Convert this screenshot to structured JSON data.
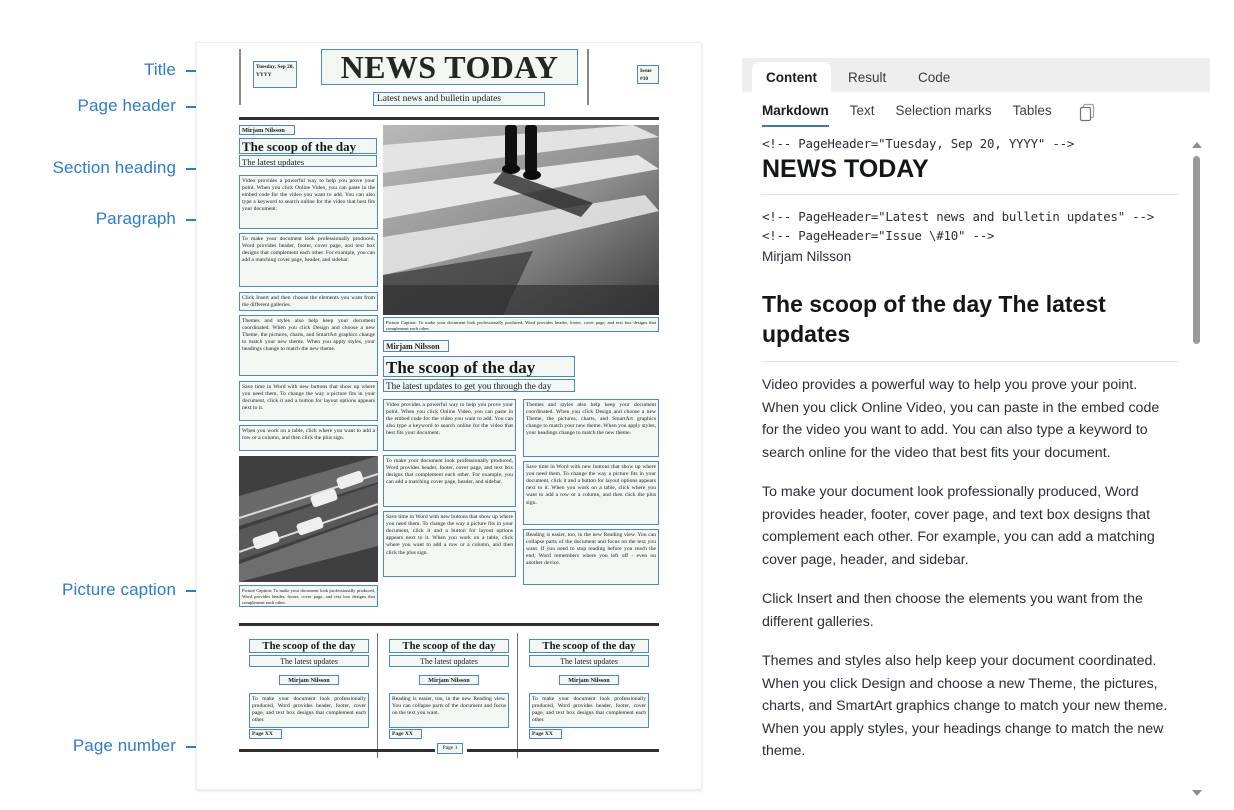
{
  "annotations": [
    {
      "label": "Title",
      "target": "document-title"
    },
    {
      "label": "Page header",
      "target": "page-header"
    },
    {
      "label": "Section heading",
      "target": "section-heading"
    },
    {
      "label": "Paragraph",
      "target": "paragraph"
    },
    {
      "label": "Picture caption",
      "target": "picture-caption"
    },
    {
      "label": "Page number",
      "target": "page-number"
    }
  ],
  "accent_color": "#2b7cd3",
  "region_outline_color": "#4a86d8",
  "document": {
    "masthead": {
      "title": "NEWS TODAY",
      "date": "Tuesday, Sep 20, YYYY",
      "issue": "Issue #10",
      "subtitle": "Latest news and bulletin updates"
    },
    "section_one": {
      "byline": "Mirjam Nilsson",
      "heading": "The scoop of the day",
      "subheading": "The latest updates",
      "paragraphs": [
        "Video provides a powerful way to help you prove your point. When you click Online Video, you can paste in the embed code for the video you want to add. You can also type a keyword to search online for the video that best fits your document.",
        "To make your document look professionally produced, Word provides header, footer, cover page, and text box designs that complement each other. For example, you can add a matching cover page, header, and sidebar.",
        "Click Insert and then choose the elements you want from the different galleries.",
        "Themes and styles also help keep your document coordinated. When you click Design and choose a new Theme, the pictures, charts, and SmartArt graphics change to match your new theme. When you apply styles, your headings change to match the new theme.",
        "Save time in Word with new buttons that show up where you need them. To change the way a picture fits in your document, click it and a button for layout options appears next to it.",
        "When you work on a table, click where you want to add a row or a column, and then click the plus sign."
      ],
      "caption_top": "Picture Caption: To make your document look professionally produced, Word provides header, footer, cover page, and text box designs that complement each other.",
      "caption_bottom": "Picture Caption: To make your document look professionally produced, Word provides header, footer, cover page, and text box designs that complement each other."
    },
    "section_two": {
      "byline": "Mirjam Nilsson",
      "heading": "The scoop of the day",
      "subheading": "The latest updates to get you through the day",
      "left_column": [
        "Video provides a powerful way to help you prove your point. When you click Online Video, you can paste in the embed code for the video you want to add. You can also type a keyword to search online for the video that best fits your document.",
        "To make your document look professionally produced, Word provides header, footer, cover page, and text box designs that complement each other. For example, you can add a matching cover page, header, and sidebar.",
        "Save time in Word with new buttons that show up where you need them. To change the way a picture fits in your document, click it and a button for layout options appears next to it. When you work on a table, click where you want to add a row or a column, and then click the plus sign."
      ],
      "right_column": [
        "Themes and styles also help keep your document coordinated. When you click Design and choose a new Theme, the pictures, charts, and SmartArt graphics change to match your new theme. When you apply styles, your headings change to match the new theme.",
        "Save time in Word with new buttons that show up where you need them. To change the way a picture fits in your document, click it and a button for layout options appears next to it. When you work on a table, click where you want to add a row or a column, and then click the plus sign.",
        "Reading is easier, too, in the new Reading view. You can collapse parts of the document and focus on the text you want. If you need to stop reading before you reach the end, Word remembers where you left off - even on another device."
      ]
    },
    "cards": [
      {
        "heading": "The scoop of the day",
        "subheading": "The latest updates",
        "byline": "Mirjam Nilsson",
        "body": "To make your document look professionally produced, Word provides header, footer, cover page, and text box designs that complement each other.",
        "page_label": "Page XX"
      },
      {
        "heading": "The scoop of the day",
        "subheading": "The latest updates",
        "byline": "Mirjam Nilsson",
        "body": "Reading is easier, too, in the new Reading view. You can collapse parts of the document and focus on the text you want.",
        "page_label": "Page XX"
      },
      {
        "heading": "The scoop of the day",
        "subheading": "The latest updates",
        "byline": "Mirjam Nilsson",
        "body": "To make your document look professionally produced, Word provides header, footer, cover page, and text box designs that complement each other.",
        "page_label": "Page XX"
      }
    ],
    "footer_page_number": "Page 1"
  },
  "panel": {
    "tabs": [
      {
        "label": "Content",
        "active": true
      },
      {
        "label": "Result",
        "active": false
      },
      {
        "label": "Code",
        "active": false
      }
    ],
    "subtabs": [
      {
        "label": "Markdown",
        "active": true
      },
      {
        "label": "Text",
        "active": false
      },
      {
        "label": "Selection marks",
        "active": false
      },
      {
        "label": "Tables",
        "active": false
      }
    ],
    "copy_icon": "copy-icon",
    "markdown": {
      "comment_1": "<!-- PageHeader=\"Tuesday, Sep 20, YYYY\" -->",
      "h1": "NEWS TODAY",
      "comment_2": "<!-- PageHeader=\"Latest news and bulletin updates\" --> <!-- PageHeader=\"Issue \\#10\" -->",
      "author": "Mirjam Nilsson",
      "h2": "The scoop of the day The latest updates",
      "paragraphs": [
        "Video provides a powerful way to help you prove your point. When you click Online Video, you can paste in the embed code for the video you want to add. You can also type a keyword to search online for the video that best fits your document.",
        "To make your document look professionally produced, Word provides header, footer, cover page, and text box designs that complement each other. For example, you can add a matching cover page, header, and sidebar.",
        "Click Insert and then choose the elements you want from the different galleries.",
        "Themes and styles also help keep your document coordinated. When you click Design and choose a new Theme, the pictures, charts, and SmartArt graphics change to match your new theme. When you apply styles, your headings change to match the new theme."
      ]
    }
  }
}
